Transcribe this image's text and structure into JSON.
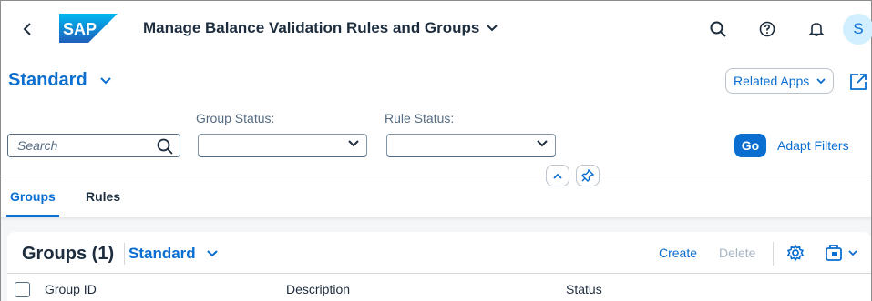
{
  "shell": {
    "app_title": "Manage Balance Validation Rules and Groups",
    "logo_text": "SAP",
    "avatar_initial": "S"
  },
  "header": {
    "variant": "Standard",
    "related_apps": "Related Apps"
  },
  "filters": {
    "search_placeholder": "Search",
    "group_status_label": "Group Status:",
    "group_status_value": "",
    "rule_status_label": "Rule Status:",
    "rule_status_value": "",
    "go_label": "Go",
    "adapt_label": "Adapt Filters"
  },
  "tabs": [
    {
      "label": "Groups",
      "active": true
    },
    {
      "label": "Rules",
      "active": false
    }
  ],
  "table": {
    "title": "Groups (1)",
    "variant": "Standard",
    "create_label": "Create",
    "delete_label": "Delete",
    "columns": [
      "Group ID",
      "Description",
      "Status"
    ]
  },
  "colors": {
    "accent": "#0a6ed1",
    "text": "#1d2d3e",
    "muted": "#556b82",
    "disabled": "#a7b5c3"
  },
  "icons": [
    "back-icon",
    "search-icon",
    "help-icon",
    "bell-icon",
    "chevron-down-icon",
    "share-icon",
    "collapse-icon",
    "pin-icon",
    "gear-icon",
    "export-icon"
  ]
}
